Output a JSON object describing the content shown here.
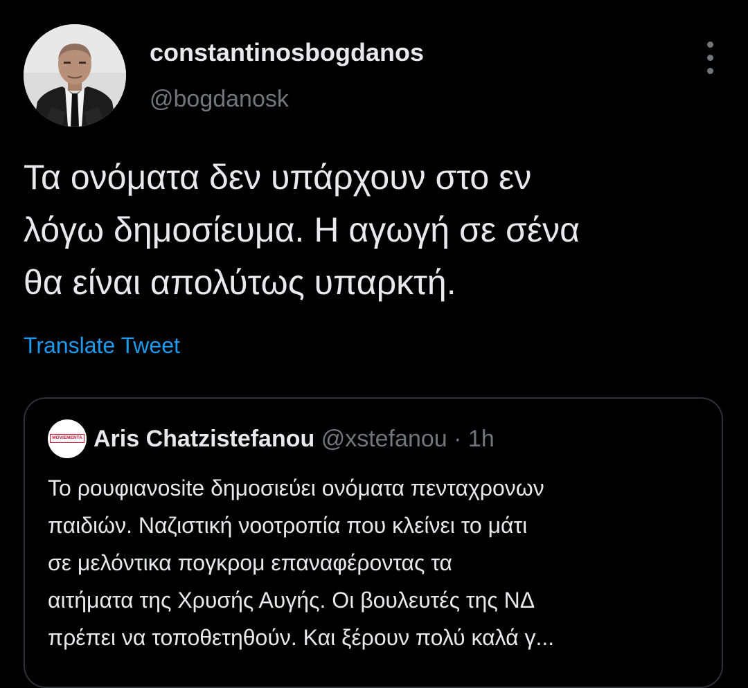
{
  "tweet": {
    "author": {
      "display_name": "constantinosbogdanos",
      "handle": "@bogdanosk",
      "avatar_icon": "profile-photo"
    },
    "more_icon": "more-options-icon",
    "text": "Τα ονόματα δεν υπάρχουν στο εν\nλόγω δημοσίευμα. Η αγωγή σε σένα\nθα είναι απολύτως υπαρκτή.",
    "translate_label": "Translate Tweet"
  },
  "quoted_tweet": {
    "author": {
      "display_name": "Aris Chatzistefanou",
      "handle": "@xstefanou",
      "separator": "·",
      "time": "1h",
      "avatar_text": "MOVIEMENTA"
    },
    "text": "Το ρουφιανοsite δημοσιεύει ονόματα πενταχρονων\nπαιδιών. Ναζιστική νοοτροπία που κλείνει το μάτι\nσε μελόντικα πογκρομ επαναφέροντας τα\nαιτήματα της Χρυσής Αυγής. Οι βουλευτές της ΝΔ\nπρέπει να τοποθετηθούν. Και ξέρουν πολύ καλά γ..."
  },
  "colors": {
    "background": "#000000",
    "primary_text": "#e7e9ea",
    "secondary_text": "#71767b",
    "link": "#1d9bf0",
    "border": "#2f3336"
  }
}
